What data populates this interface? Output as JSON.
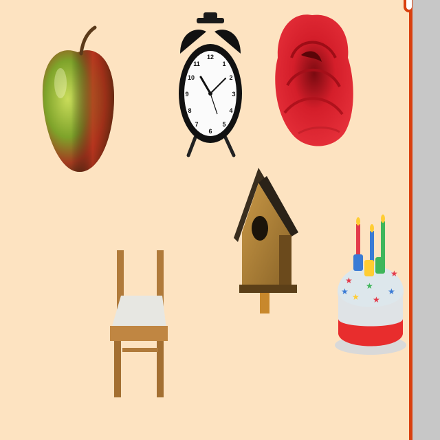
{
  "colors": {
    "canvas_background": "#fde3c1",
    "side_panel": "#c7c7c7",
    "divider_accent": "#d9400f"
  },
  "objects": [
    {
      "name": "apple",
      "icon": "apple-icon"
    },
    {
      "name": "alarm clock",
      "icon": "alarm-clock-icon"
    },
    {
      "name": "rose",
      "icon": "rose-icon"
    },
    {
      "name": "birdhouse",
      "icon": "birdhouse-icon"
    },
    {
      "name": "chair",
      "icon": "chair-icon"
    },
    {
      "name": "birthday cake",
      "icon": "birthday-cake-icon"
    }
  ]
}
